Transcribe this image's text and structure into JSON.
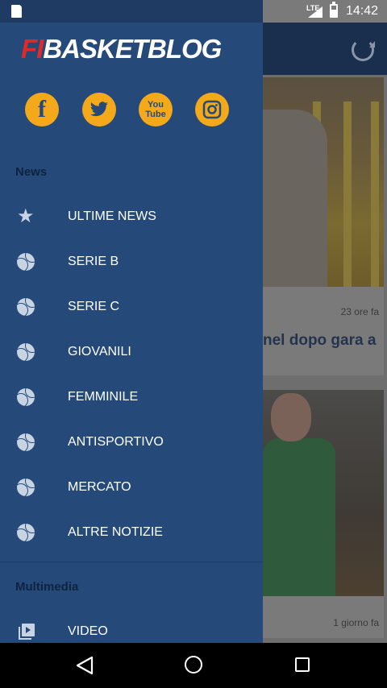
{
  "status_bar": {
    "network": "LTE",
    "time": "14:42"
  },
  "feed": {
    "cards": [
      {
        "time": "23 ore fa",
        "headline": "nel dopo gara a"
      },
      {
        "time": "1 giorno fa"
      }
    ]
  },
  "drawer": {
    "logo": {
      "fi": "FI",
      "rest": "BASKETBLOG"
    },
    "socials": [
      {
        "name": "facebook-icon",
        "label": "f"
      },
      {
        "name": "twitter-icon"
      },
      {
        "name": "youtube-icon",
        "label_top": "You",
        "label_bottom": "Tube"
      },
      {
        "name": "instagram-icon"
      }
    ],
    "sections": {
      "news": "News",
      "multimedia": "Multimedia"
    },
    "news_items": [
      {
        "label": "ULTIME NEWS",
        "icon": "star-icon"
      },
      {
        "label": "SERIE B",
        "icon": "basketball-icon"
      },
      {
        "label": "SERIE C",
        "icon": "basketball-icon"
      },
      {
        "label": "GIOVANILI",
        "icon": "basketball-icon"
      },
      {
        "label": "FEMMINILE",
        "icon": "basketball-icon"
      },
      {
        "label": "ANTISPORTIVO",
        "icon": "basketball-icon"
      },
      {
        "label": "MERCATO",
        "icon": "basketball-icon"
      },
      {
        "label": "ALTRE NOTIZIE",
        "icon": "basketball-icon"
      }
    ],
    "multimedia_items": [
      {
        "label": "VIDEO",
        "icon": "video-library-icon"
      }
    ]
  },
  "colors": {
    "drawer_bg": "#254a7a",
    "accent": "#f4a91b",
    "logo_red": "#e02a2a"
  }
}
